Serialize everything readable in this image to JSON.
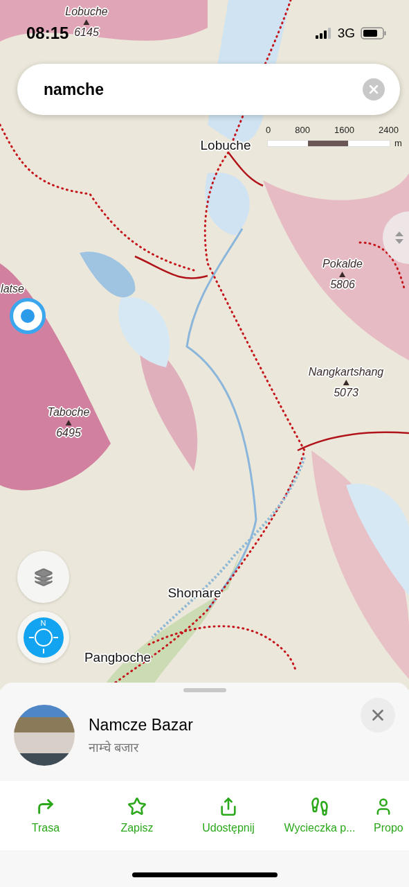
{
  "status_bar": {
    "time": "08:15",
    "network": "3G"
  },
  "search": {
    "value": "namche"
  },
  "scale": {
    "ticks": [
      "0",
      "800",
      "1600",
      "2400"
    ],
    "unit": "m"
  },
  "map_labels": [
    {
      "kind": "peak",
      "name": "Lobuche",
      "elevation": "6145"
    },
    {
      "kind": "place",
      "name": "Lobuche"
    },
    {
      "kind": "peak",
      "name": "Pokalde",
      "elevation": "5806"
    },
    {
      "kind": "peak",
      "name": "latse"
    },
    {
      "kind": "peak",
      "name": "Nangkartshang",
      "elevation": "5073"
    },
    {
      "kind": "peak",
      "name": "Taboche",
      "elevation": "6495"
    },
    {
      "kind": "place",
      "name": "Shomare"
    },
    {
      "kind": "place",
      "name": "Pangboche"
    }
  ],
  "compass": {
    "label": "N"
  },
  "place": {
    "title": "Namcze Bazar",
    "subtitle": "नाम्चे बजार"
  },
  "actions": [
    {
      "kind": "route",
      "label": "Trasa"
    },
    {
      "kind": "save",
      "label": "Zapisz"
    },
    {
      "kind": "share",
      "label": "Udostępnij"
    },
    {
      "kind": "hike",
      "label": "Wycieczka p..."
    },
    {
      "kind": "suggest",
      "label": "Propo"
    }
  ]
}
